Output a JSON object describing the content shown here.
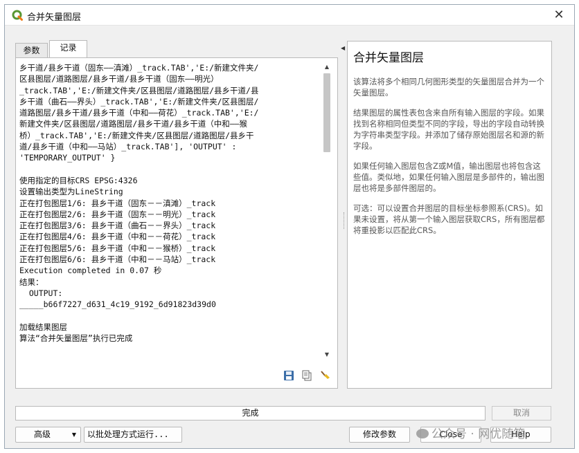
{
  "window": {
    "title": "合并矢量图层",
    "close_symbol": "✕",
    "app_icon": "qgis-icon"
  },
  "tabs": [
    {
      "label": "参数",
      "active": false
    },
    {
      "label": "记录",
      "active": true
    }
  ],
  "log": {
    "lines": [
      "乡干道/县乡干道（固东——滇滩）_track.TAB','E:/新建文件夹/",
      "区县图层/道路图层/县乡干道/县乡干道（固东——明光）",
      "_track.TAB','E:/新建文件夹/区县图层/道路图层/县乡干道/县",
      "乡干道（曲石——界头）_track.TAB','E:/新建文件夹/区县图层/",
      "道路图层/县乡干道/县乡干道（中和——荷花）_track.TAB','E:/",
      "新建文件夹/区县图层/道路图层/县乡干道/县乡干道（中和——猴",
      "桥）_track.TAB','E:/新建文件夹/区县图层/道路图层/县乡干",
      "道/县乡干道（中和——马站）_track.TAB'], 'OUTPUT' :",
      "'TEMPORARY_OUTPUT' }",
      "",
      "使用指定的目标CRS EPSG:4326",
      "设置输出类型为LineString",
      "正在打包图层1/6: 县乡干道（固东－－滇滩）_track",
      "正在打包图层2/6: 县乡干道（固东－－明光）_track",
      "正在打包图层3/6: 县乡干道（曲石－－界头）_track",
      "正在打包图层4/6: 县乡干道（中和－－荷花）_track",
      "正在打包图层5/6: 县乡干道（中和－－猴桥）_track",
      "正在打包图层6/6: 县乡干道（中和－－马站）_track",
      "Execution completed in 0.07 秒",
      "结果：",
      "  OUTPUT:",
      "_____b66f7227_d631_4c19_9192_6d91823d39d0",
      "",
      "加载结果图层",
      "算法“合并矢量图层”执行已完成"
    ],
    "tool_icons": [
      "save-icon",
      "copy-icon",
      "clear-icon"
    ]
  },
  "help": {
    "title": "合并矢量图层",
    "paragraphs": [
      "该算法将多个相同几何图形类型的矢量图层合并为一个矢量图层。",
      "结果图层的属性表包含来自所有输入图层的字段。如果找到名称相同但类型不同的字段，导出的字段自动转换为字符串类型字段。并添加了储存原始图层名和源的新字段。",
      "如果任何输入图层包含Z或M值，输出图层也将包含这些值。类似地，如果任何输入图层是多部件的，输出图层也将是多部件图层的。",
      "可选：可以设置合并图层的目标坐标参照系(CRS)。如果未设置，将从第一个输入图层获取CRS，所有图层都将重投影以匹配此CRS。"
    ]
  },
  "progress": {
    "label": "完成",
    "value": 1.0
  },
  "buttons": {
    "cancel": "取消",
    "advanced": "高级",
    "advanced_arrow": "▼",
    "batch": "以批处理方式运行...",
    "modify": "修改参数",
    "close": "Close",
    "help": "Help"
  },
  "watermark": "公众号 · 网优随笔"
}
